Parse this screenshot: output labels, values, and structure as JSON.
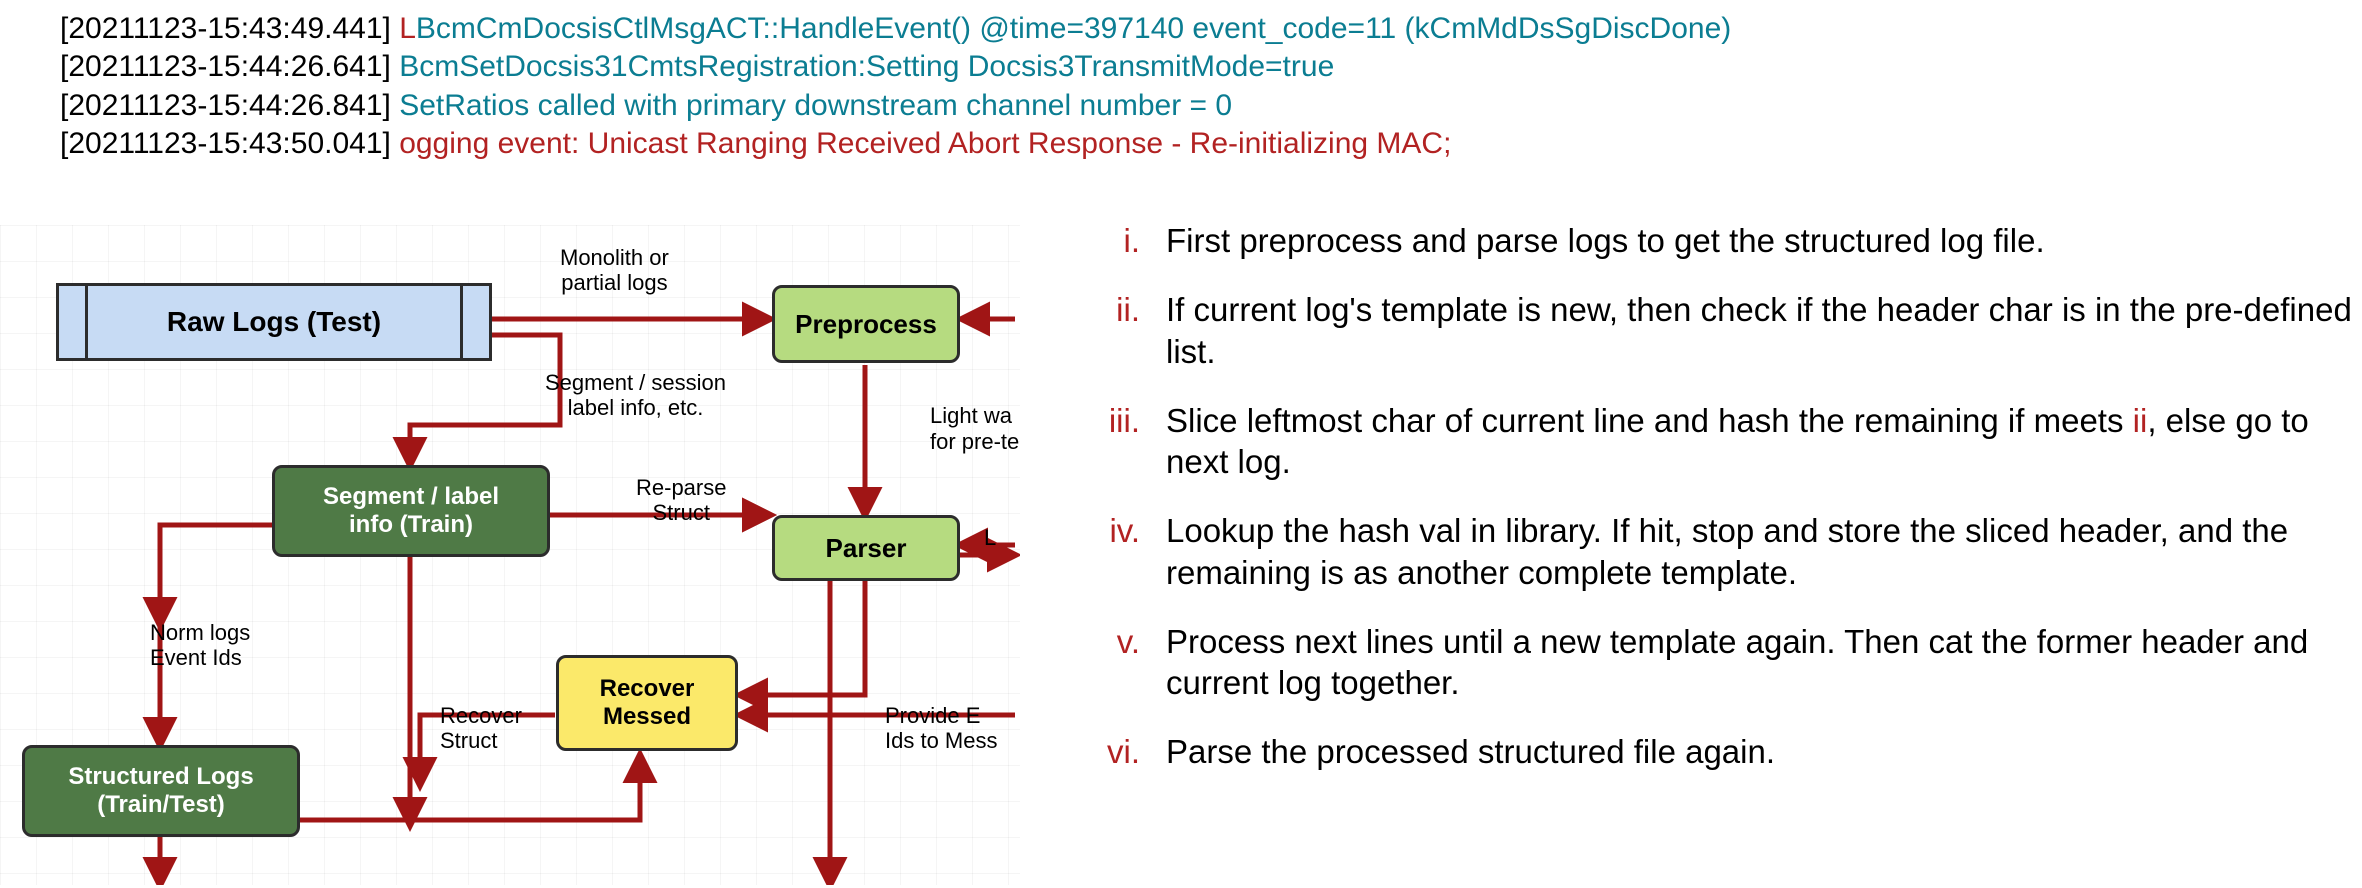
{
  "logs": [
    {
      "ts": "[20211123-15:43:49.441] ",
      "pre_red": "L",
      "teal": "BcmCmDocsisCtlMsgACT::HandleEvent() @time=397140  event_code=11 (kCmMdDsSgDiscDone)"
    },
    {
      "ts": "[20211123-15:44:26.641] ",
      "pre_red": "",
      "teal": "BcmSetDocsis31CmtsRegistration:Setting Docsis3TransmitMode=true"
    },
    {
      "ts": "[20211123-15:44:26.841] ",
      "pre_red": "",
      "teal": "SetRatios called with primary downstream channel number = 0"
    },
    {
      "ts": "[20211123-15:43:50.041] ",
      "red_only": "ogging event: Unicast Ranging Received Abort Response - Re-initializing MAC;"
    }
  ],
  "diagram": {
    "raw_logs": "Raw Logs (Test)",
    "preprocess": "Preprocess",
    "parser": "Parser",
    "recover_messed": "Recover\nMessed",
    "segment_label": "Segment / label\ninfo (Train)",
    "structured_logs": "Structured Logs\n(Train/Test)",
    "lbl_monolith": "Monolith or\npartial logs",
    "lbl_segment_session": "Segment / session\nlabel info, etc.",
    "lbl_light_wa": "Light wa",
    "lbl_for_prete": "for pre-te",
    "lbl_reparse": "Re-parse\nStruct",
    "lbl_L": "L",
    "lbl_norm_logs": "Norm logs\nEvent Ids",
    "lbl_recover_struct": "Recover\nStruct",
    "lbl_provide_e": "Provide E\nIds to Mess"
  },
  "steps": [
    {
      "num": "i.",
      "text": "First preprocess and parse logs to get the structured log file."
    },
    {
      "num": "ii.",
      "text": "If current log's template is new, then check if the header char is in the pre-defined list."
    },
    {
      "num": "iii.",
      "text_before": "Slice leftmost char of current line and hash the remaining if meets ",
      "ref": "ii",
      "text_after": ", else go to next log."
    },
    {
      "num": "iv.",
      "text": "Lookup the hash val in library. If hit, stop and store the sliced header, and the remaining is as another complete template."
    },
    {
      "num": "v.",
      "text": "Process next lines until a new template again. Then cat the former header and current log together."
    },
    {
      "num": "vi.",
      "text": "Parse the processed structured file again."
    }
  ]
}
